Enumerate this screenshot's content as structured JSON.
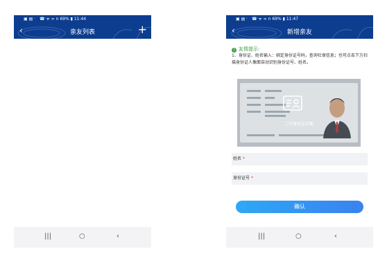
{
  "left_screen": {
    "status": {
      "left_icons": "▣ ▤ ·",
      "right_text": "☎ ᯤ ∞ 𝗇 69% ▮ 11:44"
    },
    "nav": {
      "back_glyph": "‹",
      "title": "亲友列表",
      "add_glyph": "+"
    }
  },
  "right_screen": {
    "status": {
      "left_icons": "▣ ▤ ·",
      "right_text": "☎ ᯤ ∞ 𝗇 69% ▮ 11:47"
    },
    "nav": {
      "back_glyph": "‹",
      "title": "新增亲友"
    },
    "tip": {
      "icon_glyph": "!",
      "title": "友情提示:",
      "body": "1、身份证、姓名输入：绑定身份证号码，查询社保信息；也可点击下方扫描身份证人像面自动识别身份证号、姓名。"
    },
    "id_scan": {
      "caption": "二代身份证正面"
    },
    "form": {
      "name_label": "姓名",
      "id_label": "身份证号",
      "required_mark": "*"
    },
    "confirm_label": "确认"
  },
  "system_nav": {
    "recents_glyph": "|||",
    "home_glyph": "○",
    "back_glyph": "‹"
  },
  "colors": {
    "header": "#0d3d8f",
    "tip_green": "#43a047",
    "button_start": "#2fa8f5",
    "button_end": "#3a82f0",
    "required_red": "#e53935"
  }
}
